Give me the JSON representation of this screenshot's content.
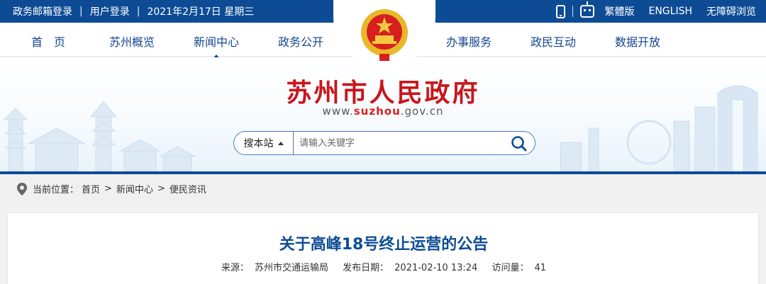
{
  "topbar": {
    "left": [
      "政务邮箱登录",
      "用户登录",
      "2021年2月17日 星期三"
    ],
    "right": [
      "繁體版",
      "ENGLISH",
      "无障碍浏览"
    ]
  },
  "nav": {
    "items": [
      "首　页",
      "苏州概览",
      "新闻中心",
      "政务公开",
      "办事服务",
      "政民互动",
      "数据开放"
    ]
  },
  "header": {
    "site_title": "苏州市人民政府",
    "url_prefix": "www.",
    "url_brand": "suzhou",
    "url_suffix": ".gov.cn"
  },
  "search": {
    "scope_label": "搜本站",
    "placeholder": "请输入关键字"
  },
  "breadcrumb": {
    "label": "当前位置：",
    "items": [
      "首页",
      "新闻中心",
      "便民资讯"
    ]
  },
  "article": {
    "title": "关于高峰18号终止运营的公告",
    "source_label": "来源：",
    "source": "苏州市交通运输局",
    "date_label": "发布日期：",
    "date": "2021-02-10 13:24",
    "views_label": "访问量：",
    "views": "41"
  },
  "icons": {
    "phone": "mobile-phone-icon",
    "robot": "robot-assistant-icon",
    "search": "search-magnifier-icon",
    "location": "location-pin-icon",
    "emblem": "national-emblem-icon"
  },
  "colors": {
    "primary_blue": "#0d4c95",
    "title_red": "#c8161d",
    "nav_text": "#14458f"
  }
}
